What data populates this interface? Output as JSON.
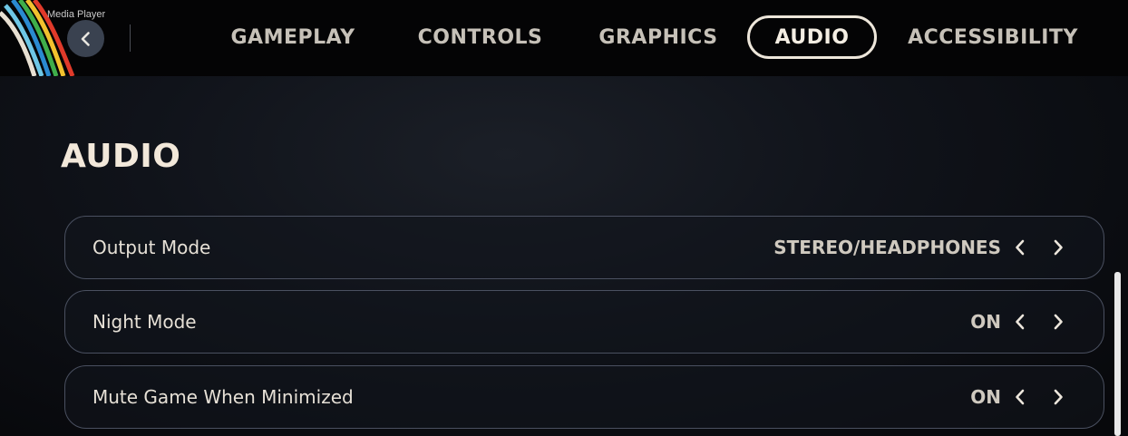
{
  "window": {
    "title": "Media Player"
  },
  "header": {
    "back_icon": "chevron-left-icon",
    "tabs": [
      {
        "label": "GAMEPLAY",
        "active": false
      },
      {
        "label": "CONTROLS",
        "active": false
      },
      {
        "label": "GRAPHICS",
        "active": false
      },
      {
        "label": "AUDIO",
        "active": true
      },
      {
        "label": "ACCESSIBILITY",
        "active": false
      }
    ]
  },
  "section": {
    "title": "AUDIO"
  },
  "settings": [
    {
      "label": "Output Mode",
      "value": "STEREO/HEADPHONES"
    },
    {
      "label": "Night Mode",
      "value": "ON"
    },
    {
      "label": "Mute Game When Minimized",
      "value": "ON"
    }
  ],
  "colors": {
    "accent": "#ede6da",
    "background": "#07080b",
    "row_border": "#4a5060",
    "stripes": [
      "#e8e0d2",
      "#6ec7e6",
      "#2a8ad0",
      "#3fae4a",
      "#f2c12e",
      "#e03a2a"
    ]
  }
}
